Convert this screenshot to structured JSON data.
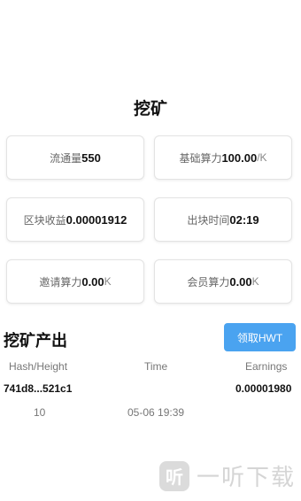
{
  "title": "挖矿",
  "stats": [
    {
      "label": "流通量",
      "value": "550",
      "unit": ""
    },
    {
      "label": "基础算力",
      "value": "100.00",
      "unit": "/K"
    },
    {
      "label": "区块收益",
      "value": "0.00001912",
      "unit": ""
    },
    {
      "label": "出块时间",
      "value": "02:19",
      "unit": ""
    },
    {
      "label": "邀请算力",
      "value": "0.00",
      "unit": " K"
    },
    {
      "label": "会员算力",
      "value": "0.00",
      "unit": " K"
    }
  ],
  "output": {
    "section_title": "挖矿产出",
    "claim_button": "领取HWT",
    "columns": [
      "Hash/Height",
      "Time",
      "Earnings"
    ],
    "rows": [
      {
        "hash": "741d8...521c1",
        "height": "10",
        "time": "05-06 19:39",
        "earnings": "0.00001980"
      }
    ]
  },
  "watermark": {
    "icon": "听",
    "text": "一听下载"
  }
}
